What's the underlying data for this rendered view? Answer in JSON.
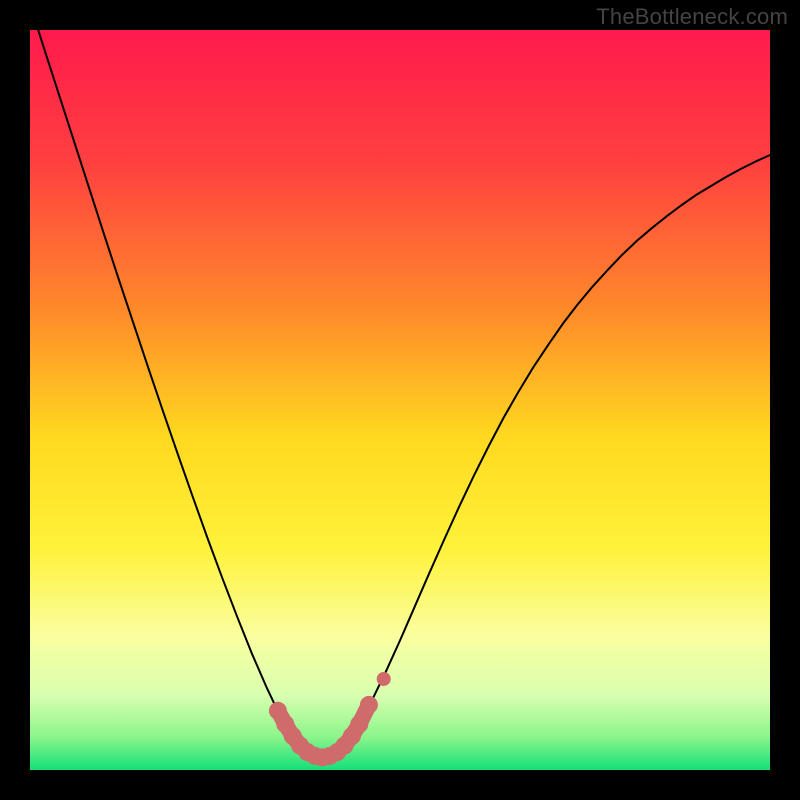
{
  "watermark": "TheBottleneck.com",
  "chart_data": {
    "type": "line",
    "title": "",
    "xlabel": "",
    "ylabel": "",
    "xlim": [
      0,
      1
    ],
    "ylim": [
      0,
      1
    ],
    "x": [
      0.0,
      0.02,
      0.04,
      0.06,
      0.08,
      0.1,
      0.12,
      0.14,
      0.16,
      0.18,
      0.2,
      0.22,
      0.24,
      0.26,
      0.28,
      0.3,
      0.32,
      0.33,
      0.34,
      0.35,
      0.36,
      0.37,
      0.38,
      0.39,
      0.4,
      0.41,
      0.42,
      0.43,
      0.44,
      0.46,
      0.48,
      0.5,
      0.52,
      0.54,
      0.56,
      0.58,
      0.6,
      0.62,
      0.64,
      0.66,
      0.68,
      0.7,
      0.72,
      0.74,
      0.76,
      0.78,
      0.8,
      0.82,
      0.84,
      0.86,
      0.88,
      0.9,
      0.92,
      0.94,
      0.96,
      0.98,
      1.0
    ],
    "values": [
      1.035,
      0.972,
      0.91,
      0.848,
      0.786,
      0.724,
      0.663,
      0.603,
      0.543,
      0.484,
      0.426,
      0.369,
      0.313,
      0.259,
      0.207,
      0.157,
      0.111,
      0.09,
      0.071,
      0.054,
      0.04,
      0.029,
      0.022,
      0.018,
      0.018,
      0.022,
      0.029,
      0.04,
      0.054,
      0.09,
      0.131,
      0.175,
      0.221,
      0.267,
      0.312,
      0.356,
      0.398,
      0.438,
      0.476,
      0.511,
      0.544,
      0.574,
      0.603,
      0.629,
      0.653,
      0.675,
      0.696,
      0.715,
      0.732,
      0.748,
      0.763,
      0.777,
      0.789,
      0.801,
      0.812,
      0.822,
      0.831
    ],
    "dip_center_x": 0.395,
    "dip_half_width": 0.055,
    "highlight_color": "#cf6b6b",
    "highlight_points": [
      {
        "x": 0.335,
        "y": 0.08
      },
      {
        "x": 0.345,
        "y": 0.062
      },
      {
        "x": 0.355,
        "y": 0.046
      },
      {
        "x": 0.365,
        "y": 0.033
      },
      {
        "x": 0.375,
        "y": 0.024
      },
      {
        "x": 0.385,
        "y": 0.019
      },
      {
        "x": 0.395,
        "y": 0.017
      },
      {
        "x": 0.405,
        "y": 0.019
      },
      {
        "x": 0.415,
        "y": 0.024
      },
      {
        "x": 0.425,
        "y": 0.033
      },
      {
        "x": 0.435,
        "y": 0.046
      },
      {
        "x": 0.445,
        "y": 0.062
      },
      {
        "x": 0.458,
        "y": 0.088
      }
    ],
    "outlier_point": {
      "x": 0.478,
      "y": 0.123
    },
    "background_gradient": {
      "stops": [
        {
          "offset": 0.0,
          "color": "#ff1a4d"
        },
        {
          "offset": 0.18,
          "color": "#ff4040"
        },
        {
          "offset": 0.38,
          "color": "#ff8a2a"
        },
        {
          "offset": 0.55,
          "color": "#ffd91f"
        },
        {
          "offset": 0.7,
          "color": "#fff23a"
        },
        {
          "offset": 0.82,
          "color": "#faffa0"
        },
        {
          "offset": 0.9,
          "color": "#d8ffb0"
        },
        {
          "offset": 0.955,
          "color": "#8bf58b"
        },
        {
          "offset": 1.0,
          "color": "#14e07a"
        }
      ]
    }
  }
}
